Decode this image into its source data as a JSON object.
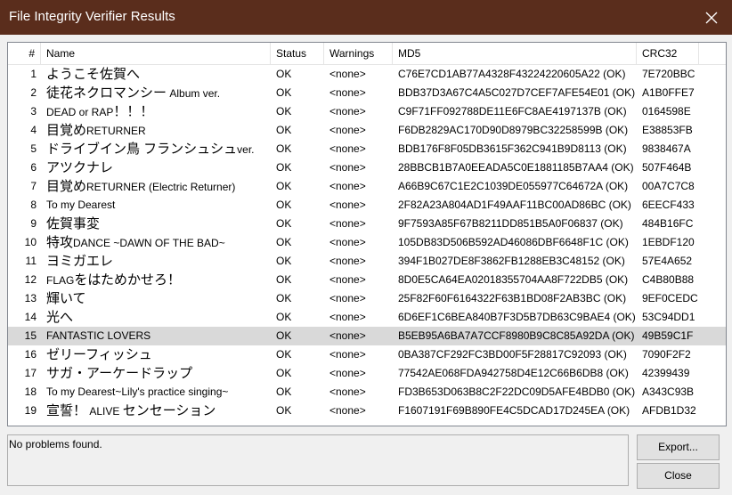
{
  "window": {
    "title": "File Integrity Verifier Results"
  },
  "columns": {
    "num": "#",
    "name": "Name",
    "status": "Status",
    "warnings": "Warnings",
    "md5": "MD5",
    "crc32": "CRC32"
  },
  "rows": [
    {
      "num": "1",
      "name_big": "ようこそ佐賀へ",
      "name_small": "",
      "status": "OK",
      "warnings": "<none>",
      "md5": "C76E7CD1AB77A4328F43224220605A22 (OK)",
      "crc32": "7E720BBC"
    },
    {
      "num": "2",
      "name_big": "徒花ネクロマンシー",
      "name_small": " Album ver.",
      "status": "OK",
      "warnings": "<none>",
      "md5": "BDB37D3A67C4A5C027D7CEF7AFE54E01 (OK)",
      "crc32": "A1B0FFE7"
    },
    {
      "num": "3",
      "name_big": "",
      "name_small": "DEAD or RAP",
      "name_big2": "！！！",
      "status": "OK",
      "warnings": "<none>",
      "md5": "C9F71FF092788DE11E6FC8AE4197137B (OK)",
      "crc32": "0164598E"
    },
    {
      "num": "4",
      "name_big": "目覚め",
      "name_small": "RETURNER",
      "status": "OK",
      "warnings": "<none>",
      "md5": "F6DB2829AC170D90D8979BC32258599B (OK)",
      "crc32": "E38853FB"
    },
    {
      "num": "5",
      "name_big": "ドライブイン鳥 フランシュシュ",
      "name_small": "ver.",
      "status": "OK",
      "warnings": "<none>",
      "md5": "BDB176F8F05DB3615F362C941B9D8113 (OK)",
      "crc32": "9838467A"
    },
    {
      "num": "6",
      "name_big": "アツクナレ",
      "name_small": "",
      "status": "OK",
      "warnings": "<none>",
      "md5": "28BBCB1B7A0EEADA5C0E1881185B7AA4 (OK)",
      "crc32": "507F464B"
    },
    {
      "num": "7",
      "name_big": "目覚め",
      "name_small": "RETURNER (Electric Returner)",
      "status": "OK",
      "warnings": "<none>",
      "md5": "A66B9C67C1E2C1039DE055977C64672A (OK)",
      "crc32": "00A7C7C8"
    },
    {
      "num": "8",
      "name_big": "",
      "name_small": "To my Dearest",
      "status": "OK",
      "warnings": "<none>",
      "md5": "2F82A23A804AD1F49AAF11BC00AD86BC (OK)",
      "crc32": "6EECF433"
    },
    {
      "num": "9",
      "name_big": "佐賀事変",
      "name_small": "",
      "status": "OK",
      "warnings": "<none>",
      "md5": "9F7593A85F67B8211DD851B5A0F06837 (OK)",
      "crc32": "484B16FC"
    },
    {
      "num": "10",
      "name_big": "特攻",
      "name_small": "DANCE ~DAWN OF THE BAD~",
      "status": "OK",
      "warnings": "<none>",
      "md5": "105DB83D506B592AD46086DBF6648F1C (OK)",
      "crc32": "1EBDF120"
    },
    {
      "num": "11",
      "name_big": "ヨミガエレ",
      "name_small": "",
      "status": "OK",
      "warnings": "<none>",
      "md5": "394F1B027DE8F3862FB1288EB3C48152 (OK)",
      "crc32": "57E4A652"
    },
    {
      "num": "12",
      "name_big": "",
      "name_small": "FLAG",
      "name_big2": "をはためかせろ！",
      "status": "OK",
      "warnings": "<none>",
      "md5": "8D0E5CA64EA02018355704AA8F722DB5 (OK)",
      "crc32": "C4B80B88"
    },
    {
      "num": "13",
      "name_big": "輝いて",
      "name_small": "",
      "status": "OK",
      "warnings": "<none>",
      "md5": "25F82F60F6164322F63B1BD08F2AB3BC (OK)",
      "crc32": "9EF0CEDC"
    },
    {
      "num": "14",
      "name_big": "光へ",
      "name_small": "",
      "status": "OK",
      "warnings": "<none>",
      "md5": "6D6EF1C6BEA840B7F3D5B7DB63C9BAE4 (OK)",
      "crc32": "53C94DD1"
    },
    {
      "num": "15",
      "name_big": "",
      "name_small": "FANTASTIC LOVERS",
      "status": "OK",
      "warnings": "<none>",
      "md5": "B5EB95A6BA7A7CCF8980B9C8C85A92DA (OK)",
      "crc32": "49B59C1F",
      "selected": true
    },
    {
      "num": "16",
      "name_big": "ゼリーフィッシュ",
      "name_small": "",
      "status": "OK",
      "warnings": "<none>",
      "md5": "0BA387CF292FC3BD00F5F28817C92093 (OK)",
      "crc32": "7090F2F2"
    },
    {
      "num": "17",
      "name_big": "サガ・アーケードラップ",
      "name_small": "",
      "status": "OK",
      "warnings": "<none>",
      "md5": "77542AE068FDA942758D4E12C66B6DB8 (OK)",
      "crc32": "42399439"
    },
    {
      "num": "18",
      "name_big": "",
      "name_small": "To my Dearest~Lily's practice singing~",
      "status": "OK",
      "warnings": "<none>",
      "md5": "FD3B653D063B8C2F22DC09D5AFE4BDB0 (OK)",
      "crc32": "A343C93B"
    },
    {
      "num": "19",
      "name_big": "宣誓！",
      "name_small": " ALIVE ",
      "name_big2": "センセーション",
      "status": "OK",
      "warnings": "<none>",
      "md5": "F1607191F69B890FE4C5DCAD17D245EA (OK)",
      "crc32": "AFDB1D32"
    }
  ],
  "status_message": "No problems found.",
  "buttons": {
    "export": "Export...",
    "close": "Close"
  },
  "colors": {
    "titlebar": "#5a2d1c",
    "selected_row": "#d9d9d9"
  }
}
